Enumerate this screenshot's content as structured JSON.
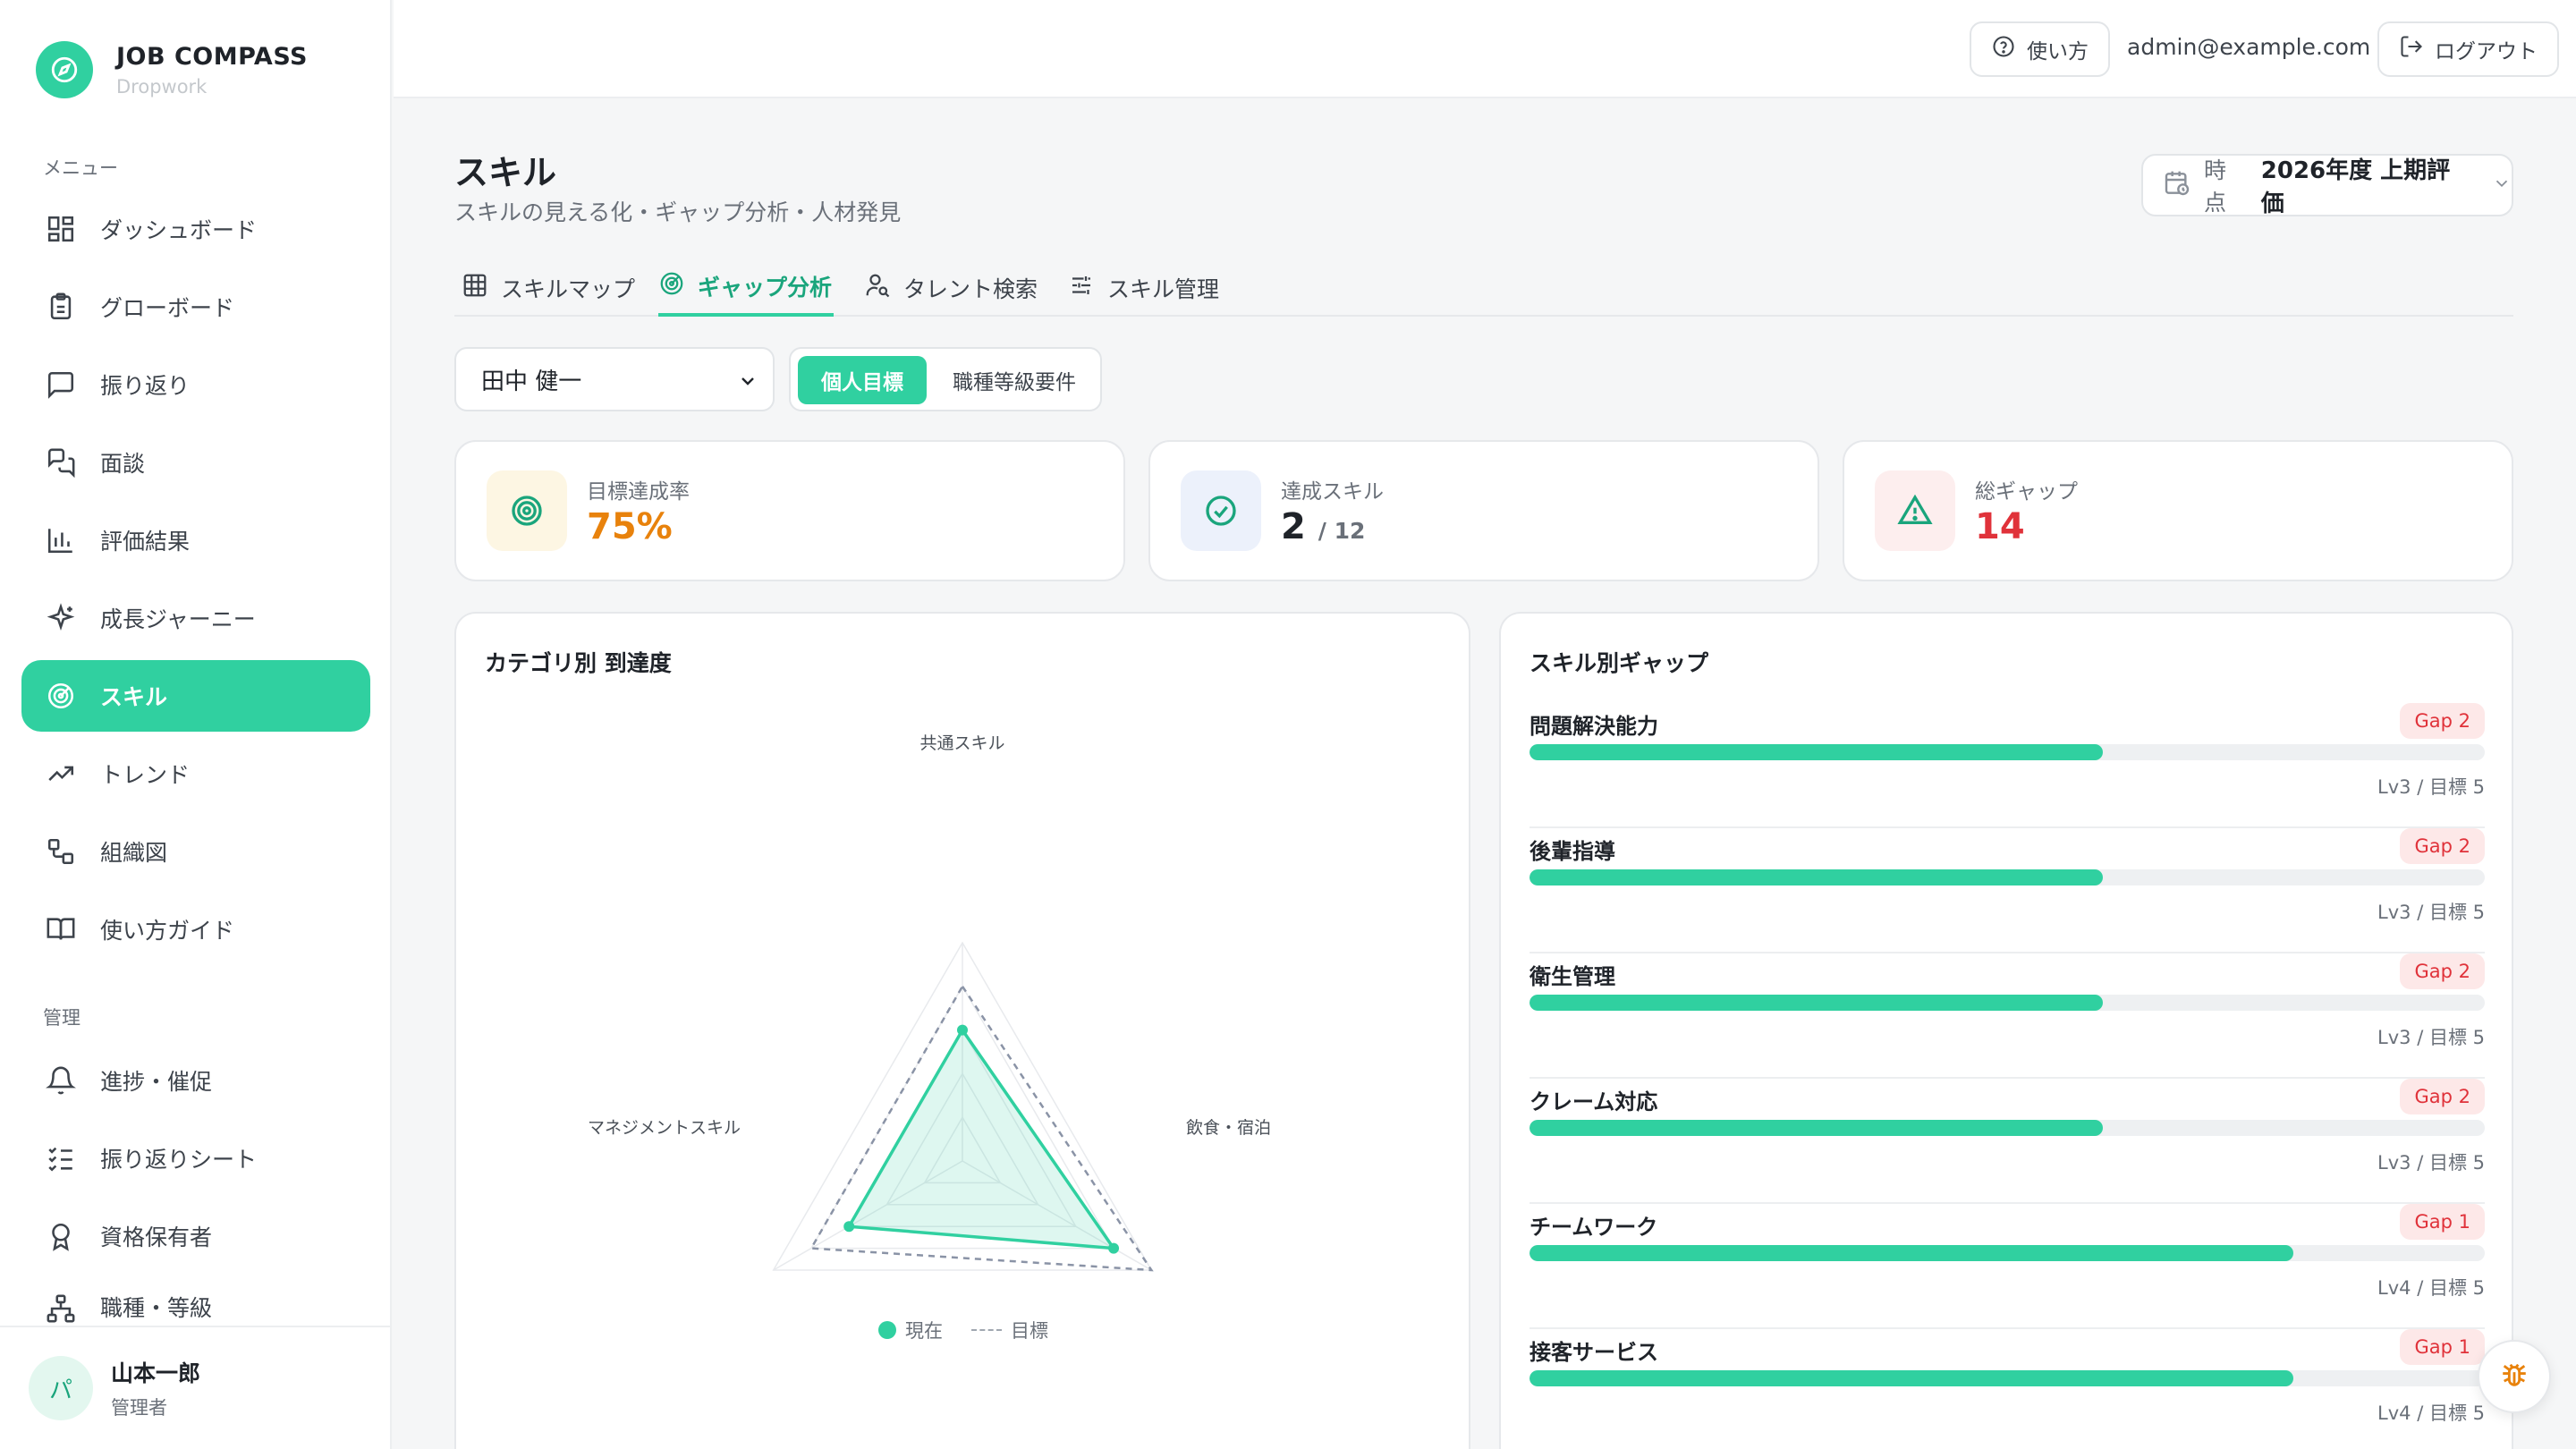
{
  "brand": {
    "name": "JOB COMPASS",
    "sub": "Dropwork"
  },
  "sidebar": {
    "menu_label": "メニュー",
    "admin_label": "管理",
    "items": [
      {
        "label": "ダッシュボード",
        "icon": "dashboard-icon"
      },
      {
        "label": "グローボード",
        "icon": "clipboard-icon"
      },
      {
        "label": "振り返り",
        "icon": "message-square-icon"
      },
      {
        "label": "面談",
        "icon": "messages-icon"
      },
      {
        "label": "評価結果",
        "icon": "bar-chart-icon"
      },
      {
        "label": "成長ジャーニー",
        "icon": "sparkles-icon"
      },
      {
        "label": "スキル",
        "icon": "radar-icon",
        "active": true
      },
      {
        "label": "トレンド",
        "icon": "trending-up-icon"
      },
      {
        "label": "組織図",
        "icon": "org-chart-icon"
      },
      {
        "label": "使い方ガイド",
        "icon": "book-icon"
      }
    ],
    "admin_items": [
      {
        "label": "進捗・催促",
        "icon": "bell-icon"
      },
      {
        "label": "振り返りシート",
        "icon": "checklist-icon"
      },
      {
        "label": "資格保有者",
        "icon": "award-icon"
      },
      {
        "label": "職種・等級",
        "icon": "hierarchy-icon"
      }
    ]
  },
  "user": {
    "avatar": "パ",
    "name": "山本一郎",
    "role": "管理者"
  },
  "topbar": {
    "help": "使い方",
    "email": "admin@example.com",
    "logout": "ログアウト"
  },
  "page": {
    "title": "スキル",
    "subtitle": "スキルの見える化・ギャップ分析・人材発見"
  },
  "period": {
    "label": "時点",
    "value": "2026年度 上期評価"
  },
  "tabs": [
    {
      "label": "スキルマップ",
      "icon": "grid-icon"
    },
    {
      "label": "ギャップ分析",
      "icon": "radar-icon",
      "active": true
    },
    {
      "label": "タレント検索",
      "icon": "user-search-icon"
    },
    {
      "label": "スキル管理",
      "icon": "sliders-icon"
    }
  ],
  "filters": {
    "person": "田中 健一",
    "seg_on": "個人目標",
    "seg_off": "職種等級要件"
  },
  "stats": [
    {
      "label": "目標達成率",
      "value": "75%",
      "color": "#e8820c",
      "icon": "target-icon"
    },
    {
      "label": "達成スキル",
      "value": "2",
      "suffix": "/ 12",
      "color": "#1f2329",
      "icon": "check-circle-icon"
    },
    {
      "label": "総ギャップ",
      "value": "14",
      "color": "#e0323a",
      "icon": "alert-triangle-icon"
    }
  ],
  "radar": {
    "title": "カテゴリ別 到達度",
    "axes": [
      "共通スキル",
      "飲食・宿泊",
      "マネジメントスキル"
    ],
    "legend_current": "現在",
    "legend_target": "目標"
  },
  "chart_data": {
    "type": "radar",
    "title": "カテゴリ別 到達度",
    "categories": [
      "共通スキル",
      "飲食・宿泊",
      "マネジメントスキル"
    ],
    "series": [
      {
        "name": "現在",
        "values": [
          3,
          4,
          3
        ]
      },
      {
        "name": "目標",
        "values": [
          4,
          5,
          4
        ]
      }
    ],
    "ylim": [
      0,
      5
    ]
  },
  "gaps": {
    "title": "スキル別ギャップ",
    "items": [
      {
        "name": "問題解決能力",
        "badge": "Gap 2",
        "level": "Lv3 / 目標 5",
        "progress": 0.6
      },
      {
        "name": "後輩指導",
        "badge": "Gap 2",
        "level": "Lv3 / 目標 5",
        "progress": 0.6
      },
      {
        "name": "衛生管理",
        "badge": "Gap 2",
        "level": "Lv3 / 目標 5",
        "progress": 0.6
      },
      {
        "name": "クレーム対応",
        "badge": "Gap 2",
        "level": "Lv3 / 目標 5",
        "progress": 0.6
      },
      {
        "name": "チームワーク",
        "badge": "Gap 1",
        "level": "Lv4 / 目標 5",
        "progress": 0.8
      },
      {
        "name": "接客サービス",
        "badge": "Gap 1",
        "level": "Lv4 / 目標 5",
        "progress": 0.8
      }
    ]
  },
  "colors": {
    "accent": "#30d0a0",
    "danger": "#e0323a",
    "warning": "#e8820c"
  }
}
